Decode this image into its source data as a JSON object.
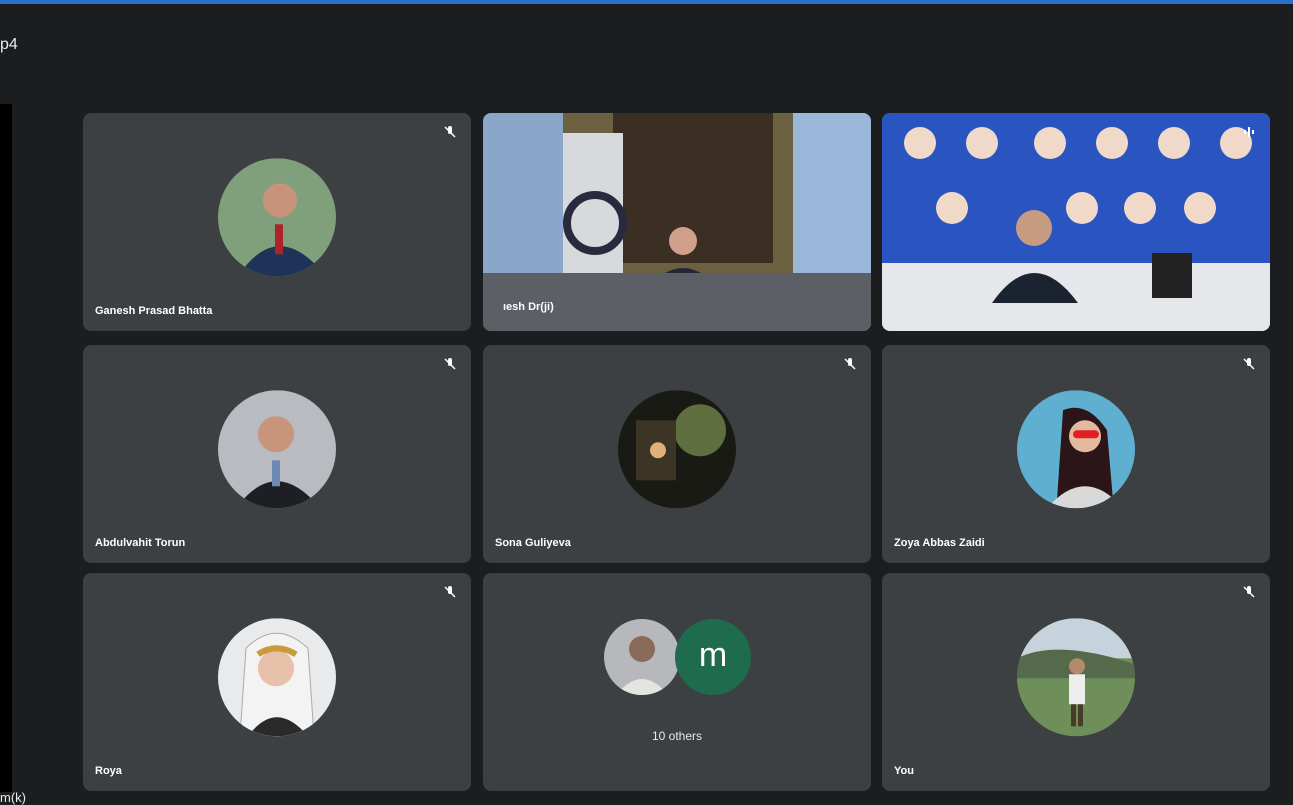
{
  "window": {
    "title_fragment": "p4",
    "bottom_fragment": "m(k)"
  },
  "participants": [
    {
      "name": "Ganesh Prasad Bhatta"
    },
    {
      "name": "ıesh Dr(ji)"
    },
    {
      "name": "Abdulvahit Torun"
    },
    {
      "name": "Sona Guliyeva"
    },
    {
      "name": "Zoya Abbas Zaidi"
    },
    {
      "name": "Roya"
    },
    {
      "others_label": "10 others",
      "avatar_letter": "m"
    },
    {
      "name": "You"
    }
  ],
  "colors": {
    "accent": "#8ab4f8",
    "tile": "#3c4043",
    "background": "#1c1d1f",
    "topbar": "#2a6fc9"
  }
}
